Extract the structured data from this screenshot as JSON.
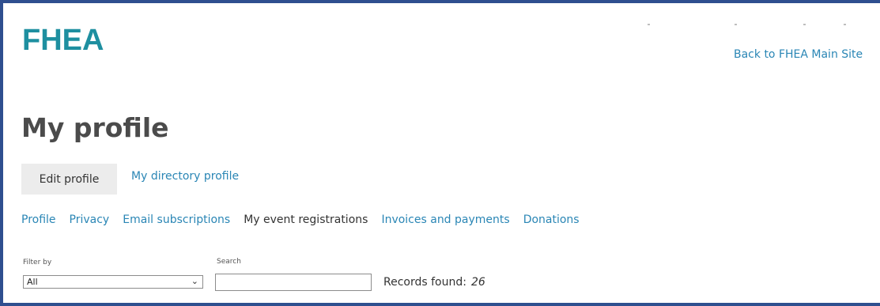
{
  "header": {
    "logo_text": "FHEA",
    "back_link": "Back to FHEA Main Site"
  },
  "page": {
    "title": "My profile"
  },
  "profile_actions": {
    "edit_profile": "Edit profile",
    "directory_profile": "My directory profile"
  },
  "subnav": {
    "items": [
      {
        "label": "Profile",
        "active": false
      },
      {
        "label": "Privacy",
        "active": false
      },
      {
        "label": "Email subscriptions",
        "active": false
      },
      {
        "label": "My event registrations",
        "active": true
      },
      {
        "label": "Invoices and payments",
        "active": false
      },
      {
        "label": "Donations",
        "active": false
      }
    ]
  },
  "filters": {
    "filter_label": "Filter by",
    "filter_value": "All",
    "search_label": "Search",
    "search_value": "",
    "records_label": "Records found:",
    "records_count": "26"
  },
  "colors": {
    "brand": "#1e8fa0",
    "link": "#2a86b5",
    "frame_border": "#2f4f8f"
  }
}
